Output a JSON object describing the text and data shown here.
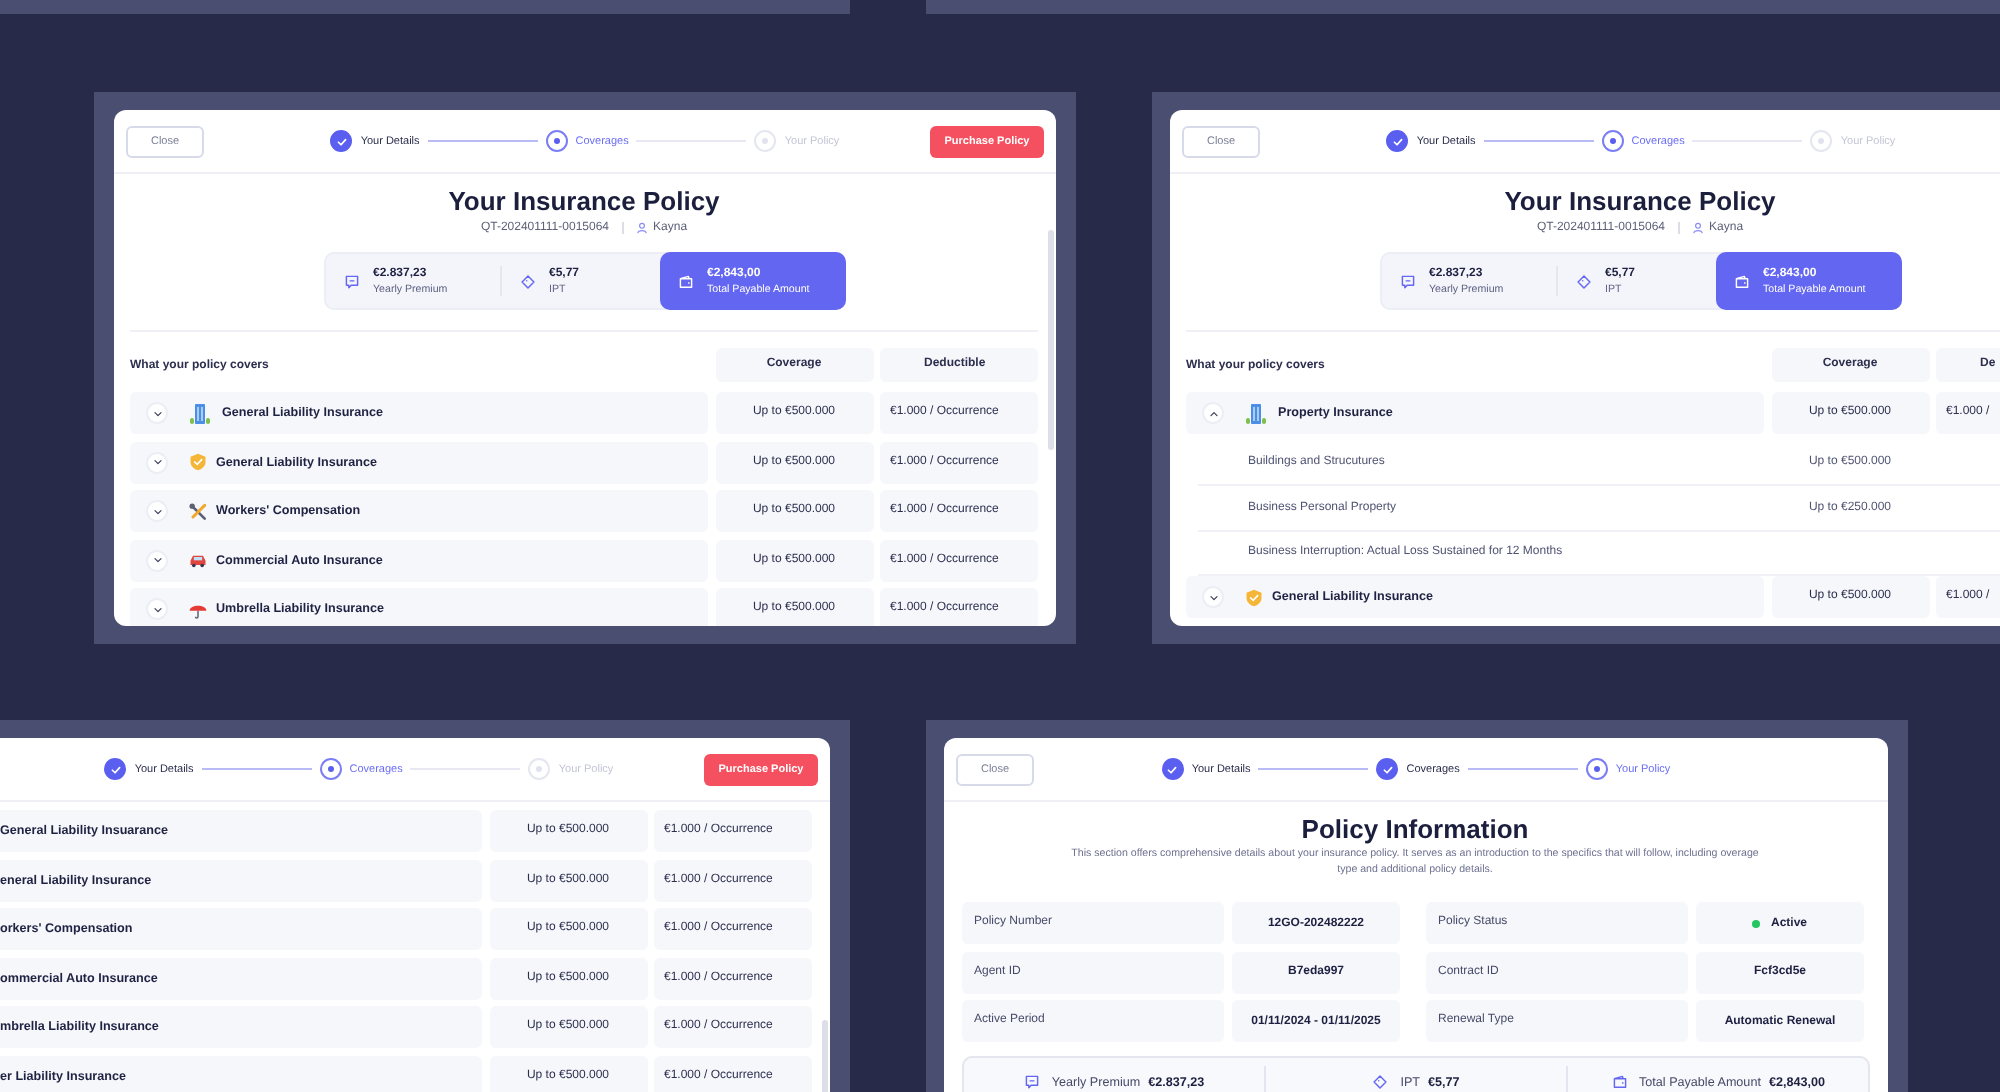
{
  "screens": [
    {
      "header": {
        "close": "Close",
        "steps": [
          {
            "label": "Your Details",
            "done": true,
            "current": false
          },
          {
            "label": "Coverages",
            "done": false,
            "current": true
          },
          {
            "label": "Your Policy",
            "done": false,
            "current": false
          }
        ],
        "purchase": "Purchase Policy"
      },
      "title": "Your Insurance Policy",
      "quote_id": "QT-202401111-0015064",
      "customer": "Kayna",
      "summary": [
        {
          "kind": "premium",
          "value": "€2.837,23",
          "label": "Yearly Premium",
          "selected": false
        },
        {
          "kind": "tax",
          "value": "€5,77",
          "label": "IPT",
          "selected": false
        },
        {
          "kind": "total",
          "value": "€2,843,00",
          "label": "Total Payable Amount",
          "selected": true
        }
      ],
      "coverage_table": {
        "caption": "What your policy covers",
        "columns": [
          "Coverage",
          "Deductible"
        ],
        "rows": [
          {
            "kind": "building",
            "name": "General Liability Insurance",
            "expanded": false,
            "coverage": "Up to €500.000",
            "deductible": "€1.000 / Occurrence"
          },
          {
            "kind": "shield",
            "name": "General Liability Insurance",
            "expanded": false,
            "coverage": "Up to €500.000",
            "deductible": "€1.000 / Occurrence"
          },
          {
            "kind": "tools",
            "name": "Workers' Compensation",
            "expanded": false,
            "coverage": "Up to €500.000",
            "deductible": "€1.000 / Occurrence"
          },
          {
            "kind": "car",
            "name": "Commercial Auto Insurance",
            "expanded": false,
            "coverage": "Up to €500.000",
            "deductible": "€1.000 / Occurrence"
          },
          {
            "kind": "umbrella",
            "name": "Umbrella Liability Insurance",
            "expanded": false,
            "coverage": "Up to €500.000",
            "deductible": "€1.000 / Occurrence"
          }
        ]
      }
    },
    {
      "header": {
        "close": "Close",
        "steps": [
          {
            "label": "Your Details",
            "done": true,
            "current": false
          },
          {
            "label": "Coverages",
            "done": false,
            "current": true
          },
          {
            "label": "Your Policy",
            "done": false,
            "current": false
          }
        ]
      },
      "title": "Your Insurance Policy",
      "quote_id": "QT-202401111-0015064",
      "customer": "Kayna",
      "summary": [
        {
          "kind": "premium",
          "value": "€2.837,23",
          "label": "Yearly Premium",
          "selected": false
        },
        {
          "kind": "tax",
          "value": "€5,77",
          "label": "IPT",
          "selected": false
        },
        {
          "kind": "total",
          "value": "€2,843,00",
          "label": "Total Payable Amount",
          "selected": true
        }
      ],
      "coverage_table": {
        "caption": "What your policy covers",
        "columns": [
          "Coverage",
          "De"
        ],
        "rows": [
          {
            "kind": "building",
            "name": "Property Insurance",
            "expanded": true,
            "coverage": "Up to €500.000",
            "deductible": "€1.000 /",
            "children": [
              {
                "name": "Buildings and Strucutures",
                "coverage": "Up to €500.000"
              },
              {
                "name": "Business Personal Property",
                "coverage": "Up to €250.000"
              },
              {
                "name": "Business Interruption: Actual Loss Sustained for 12 Months"
              }
            ]
          },
          {
            "kind": "shield",
            "name": "General Liability Insurance",
            "expanded": false,
            "coverage": "Up to €500.000",
            "deductible": "€1.000 /"
          }
        ]
      }
    },
    {
      "header": {
        "steps": [
          {
            "label": "Your Details",
            "done": true,
            "current": false
          },
          {
            "label": "Coverages",
            "done": false,
            "current": true
          },
          {
            "label": "Your Policy",
            "done": false,
            "current": false
          }
        ],
        "purchase": "Purchase Policy"
      },
      "coverage_table": {
        "rows": [
          {
            "name": "General Liability Insuarance",
            "coverage": "Up to €500.000",
            "deductible": "€1.000 / Occurrence"
          },
          {
            "name": "eneral Liability Insurance",
            "coverage": "Up to €500.000",
            "deductible": "€1.000 / Occurrence"
          },
          {
            "name": "orkers' Compensation",
            "coverage": "Up to €500.000",
            "deductible": "€1.000 / Occurrence"
          },
          {
            "name": "ommercial Auto Insurance",
            "coverage": "Up to €500.000",
            "deductible": "€1.000 / Occurrence"
          },
          {
            "name": "mbrella Liability Insurance",
            "coverage": "Up to €500.000",
            "deductible": "€1.000 / Occurrence"
          },
          {
            "name": "er Liability Insurance",
            "coverage": "Up to €500.000",
            "deductible": "€1.000 / Occurrence"
          }
        ]
      }
    },
    {
      "header": {
        "close": "Close",
        "steps": [
          {
            "label": "Your Details",
            "done": true,
            "current": false
          },
          {
            "label": "Coverages",
            "done": true,
            "current": false
          },
          {
            "label": "Your Policy",
            "done": false,
            "current": true
          }
        ]
      },
      "title": "Policy Information",
      "description": "This section offers comprehensive details about your insurance policy. It serves as an introduction to the specifics that will follow, including overage type and additional policy details.",
      "details": [
        {
          "label": "Policy Number",
          "value": "12GO-202482222"
        },
        {
          "label": "Policy Status",
          "value": "Active",
          "color": "#22c55e"
        },
        {
          "label": "Agent ID",
          "value": "B7eda997"
        },
        {
          "label": "Contract ID",
          "value": "Fcf3cd5e"
        },
        {
          "label": "Active Period",
          "value": "01/11/2024 - 01/11/2025"
        },
        {
          "label": "Renewal Type",
          "value": "Automatic Renewal"
        }
      ],
      "totals": [
        {
          "kind": "premium",
          "label": "Yearly Premium",
          "value": "€2.837,23"
        },
        {
          "kind": "tax",
          "label": "IPT",
          "value": "€5,77"
        },
        {
          "kind": "total",
          "label": "Total Payable Amount",
          "value": "€2,843,00"
        }
      ]
    }
  ]
}
